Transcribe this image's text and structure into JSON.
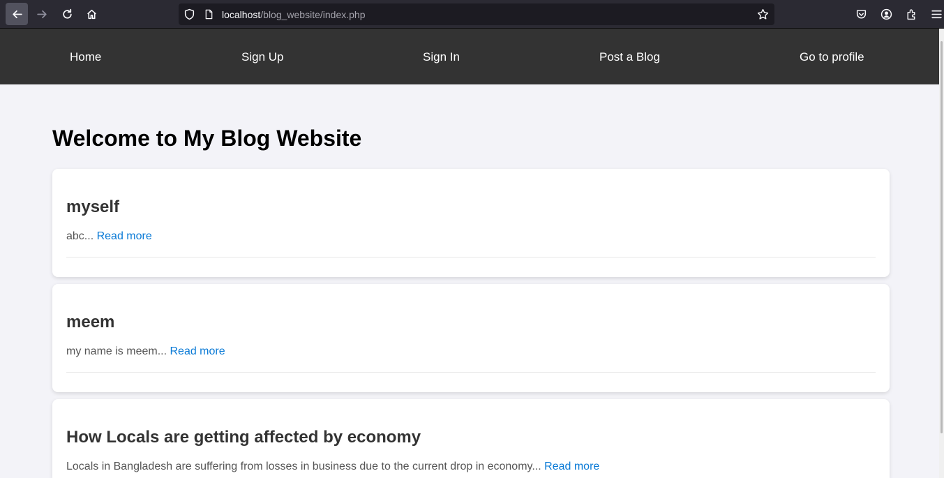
{
  "browser": {
    "url_host": "localhost",
    "url_path": "/blog_website/index.php",
    "colors": {
      "chrome": "#2b2a33",
      "urlbar": "#1c1b22"
    },
    "icons": [
      "back-arrow-icon",
      "forward-arrow-icon",
      "reload-icon",
      "home-icon",
      "shield-icon",
      "page-icon",
      "bookmark-star-icon",
      "pocket-icon",
      "account-icon",
      "extensions-icon",
      "menu-icon"
    ]
  },
  "site_nav": {
    "background": "#333333",
    "items": [
      {
        "label": "Home"
      },
      {
        "label": "Sign Up"
      },
      {
        "label": "Sign In"
      },
      {
        "label": "Post a Blog"
      },
      {
        "label": "Go to profile"
      }
    ]
  },
  "main": {
    "title": "Welcome to My Blog Website",
    "read_more_label": "Read more",
    "posts": [
      {
        "title": "myself",
        "excerpt": "abc..."
      },
      {
        "title": "meem",
        "excerpt": "my name is meem..."
      },
      {
        "title": "How Locals are getting affected by economy",
        "excerpt": "Locals in Bangladesh are suffering from losses in business due to the current drop in economy..."
      }
    ],
    "colors": {
      "link": "#0a7ad6",
      "background": "#f3f3f8"
    }
  }
}
